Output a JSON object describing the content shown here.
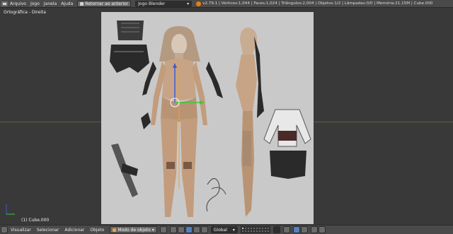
{
  "topbar": {
    "menus": [
      "Arquivo",
      "Jogo",
      "Janela",
      "Ajuda"
    ],
    "back_button_label": "Retornar ao anterior",
    "engine_select": "Jogo Blender",
    "stats": "v2.79.1 | Vértices:1,044 | Faces:1,024 | Triângulos:2,004 | Objetos:1/2 | Lâmpadas:0/0 | Memória:21.15M | Cube.000"
  },
  "viewport": {
    "view_title": "Ortográfica - Direita",
    "object_label": "(1) Cube.000"
  },
  "bottombar": {
    "menus": [
      "Visualizar",
      "Selecionar",
      "Adicionar",
      "Objeto"
    ],
    "mode_select": "Modo de objeto",
    "orientation_select": "Global"
  },
  "colors": {
    "background": "#393939",
    "header": "#4a4a4a",
    "reference_bg": "#c9c9c9",
    "accent_blue": "#5680c2",
    "blender_orange": "#e87d0d"
  }
}
